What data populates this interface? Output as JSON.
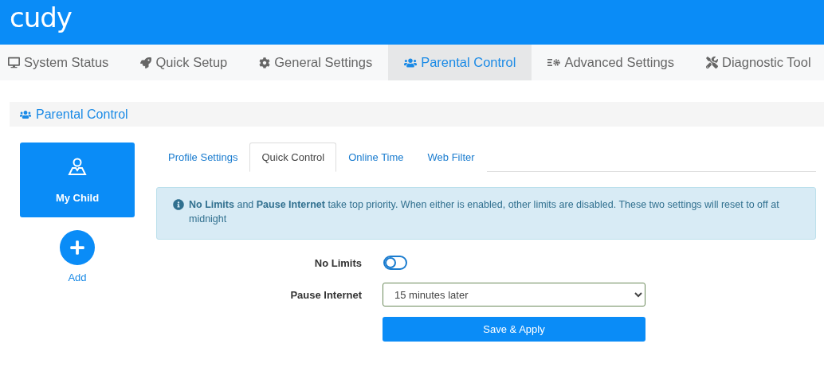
{
  "logo": "cudy",
  "nav": [
    {
      "label": "System Status",
      "selected": false
    },
    {
      "label": "Quick Setup",
      "selected": false
    },
    {
      "label": "General Settings",
      "selected": false
    },
    {
      "label": "Parental Control",
      "selected": true
    },
    {
      "label": "Advanced Settings",
      "selected": false
    },
    {
      "label": "Diagnostic Tool",
      "selected": false
    }
  ],
  "section_title": "Parental Control",
  "profiles": [
    {
      "name": "My Child",
      "selected": true
    }
  ],
  "add_label": "Add",
  "tabs": [
    {
      "label": "Profile Settings",
      "selected": false
    },
    {
      "label": "Quick Control",
      "selected": true
    },
    {
      "label": "Online Time",
      "selected": false
    },
    {
      "label": "Web Filter",
      "selected": false
    }
  ],
  "notice": "**No Limits** and **Pause Internet** take top priority. When either is enabled, other limits are disabled. These two settings will reset to off at midnight",
  "form": {
    "no_limits": {
      "label": "No Limits",
      "on": false
    },
    "pause_internet": {
      "label": "Pause Internet",
      "value": "15 minutes later"
    },
    "save_button": "Save & Apply"
  }
}
